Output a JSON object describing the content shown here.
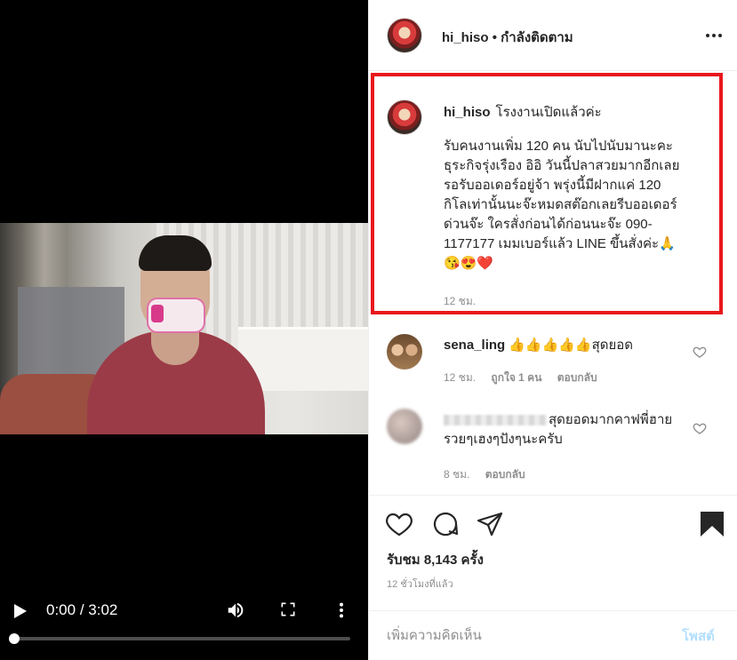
{
  "video": {
    "time_current": "0:00",
    "time_sep": "/",
    "time_total": "3:02",
    "progress_fraction": 0.0
  },
  "header": {
    "username": "hi_hiso",
    "separator": "•",
    "follow_status": "กำลังติดตาม"
  },
  "caption": {
    "username": "hi_hiso",
    "title": "โรงงานเปิดแล้วค่ะ",
    "body": "รับคนงานเพิ่ม 120 คน นับไปนับมานะคะ\nธุระกิจรุ่งเรือง อิอิ วันนี้ปลาสวยมากอีกเลย\nรอรับออเดอร์อยู่จ้า พรุ่งนี้มีฝากแค่ 120\nกิโลเท่านั้นนะจ๊ะหมดสต๊อกเลยรีบออเดอร์\nด่วนจ๊ะ ใครสั่งก่อนได้ก่อนนะจ๊ะ 090-\n1177177 เมมเบอร์แล้ว LINE ขึ้นสั่งค่ะ🙏\n😘😍❤️",
    "time": "12 ชม."
  },
  "comments": [
    {
      "username": "sena_ling",
      "text": "👍👍👍👍👍สุดยอด",
      "time": "12 ชม.",
      "likes": "ถูกใจ 1 คน",
      "reply": "ตอบกลับ"
    },
    {
      "username": "",
      "text": "สุดยอดมากคาฟพี่ฮาย รวยๆเฮงๆปังๆนะครับ",
      "time": "8 ชม.",
      "reply": "ตอบกลับ"
    }
  ],
  "actions": {
    "likes_label": "รับชม 8,143 ครั้ง",
    "posted": "12 ชั่วโมงที่แล้ว"
  },
  "add_comment": {
    "placeholder": "เพิ่มความคิดเห็น",
    "post_label": "โพสต์"
  },
  "colors": {
    "highlight_border": "#e8171b",
    "post_button_disabled": "#b2dffc"
  }
}
